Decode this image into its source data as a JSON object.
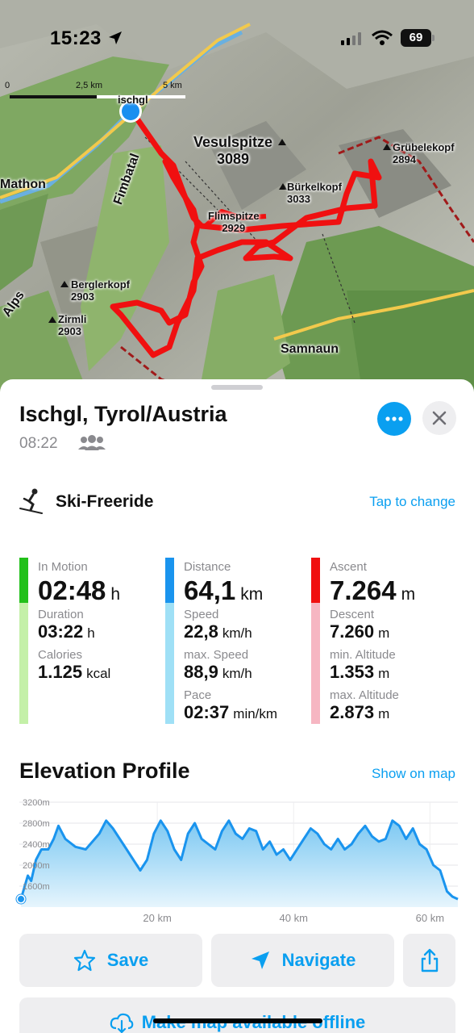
{
  "status_bar": {
    "time": "15:23",
    "battery": "69"
  },
  "map": {
    "scale": {
      "zero": "0",
      "mid": "2,5 km",
      "end": "5 km"
    },
    "labels": {
      "town_partial": "ischgl",
      "vesulspitze_name": "Vesulspitze",
      "vesulspitze_alt": "3089",
      "grubelekopf_name": "Grübelekopf",
      "grubelekopf_alt": "2894",
      "burkelkopf_name": "Bürkelkopf",
      "burkelkopf_alt": "3033",
      "flimspitze_name": "Flimspitze",
      "flimspitze_alt": "2929",
      "mathon": "Mathon",
      "fimbatal": "Fimbatal",
      "alps": "Alps",
      "berglerkopf_name": "Berglerkopf",
      "berglerkopf_alt": "2903",
      "zirmli_name": "Zirmli",
      "zirmli_alt": "2903",
      "samnaun": "Samnaun"
    }
  },
  "sheet": {
    "title": "Ischgl, Tyrol/Austria",
    "time": "08:22",
    "activity": "Ski-Freeride",
    "tap_to_change": "Tap to change",
    "stats": {
      "in_motion_label": "In Motion",
      "in_motion_value": "02:48",
      "in_motion_unit": "h",
      "duration_label": "Duration",
      "duration_value": "03:22",
      "duration_unit": "h",
      "calories_label": "Calories",
      "calories_value": "1.125",
      "calories_unit": "kcal",
      "distance_label": "Distance",
      "distance_value": "64,1",
      "distance_unit": "km",
      "speed_label": "Speed",
      "speed_value": "22,8",
      "speed_unit": "km/h",
      "max_speed_label": "max. Speed",
      "max_speed_value": "88,9",
      "max_speed_unit": "km/h",
      "pace_label": "Pace",
      "pace_value": "02:37",
      "pace_unit": "min/km",
      "ascent_label": "Ascent",
      "ascent_value": "7.264",
      "ascent_unit": "m",
      "descent_label": "Descent",
      "descent_value": "7.260",
      "descent_unit": "m",
      "min_alt_label": "min. Altitude",
      "min_alt_value": "1.353",
      "min_alt_unit": "m",
      "max_alt_label": "max. Altitude",
      "max_alt_value": "2.873",
      "max_alt_unit": "m"
    },
    "colors": {
      "motion_dark": "#22c01a",
      "motion_light": "#c4f0a8",
      "distance_dark": "#1a94ee",
      "distance_light": "#9fe0f6",
      "ascent_dark": "#f01010",
      "ascent_light": "#f6b6c2",
      "accent": "#0a9ff0"
    },
    "elevation_title": "Elevation Profile",
    "show_on_map": "Show on map",
    "buttons": {
      "save": "Save",
      "navigate": "Navigate",
      "offline": "Make map available offline"
    }
  },
  "chart_data": {
    "type": "area",
    "title": "Elevation Profile",
    "xlabel": "",
    "ylabel": "",
    "x_unit": "km",
    "y_unit": "m",
    "xlim": [
      0,
      64.1
    ],
    "ylim": [
      1200,
      3200
    ],
    "x_ticks": [
      "20 km",
      "40 km",
      "60 km"
    ],
    "y_ticks": [
      "3200m",
      "2800m",
      "2400m",
      "2000m",
      "1600m"
    ],
    "x": [
      0,
      1,
      1.5,
      2.2,
      3,
      4,
      4.8,
      5.5,
      6.5,
      8,
      9.5,
      10.5,
      11.5,
      12.5,
      13.5,
      14.5,
      15.5,
      16.5,
      17.5,
      18.5,
      19.5,
      20.5,
      21.5,
      22.5,
      23.5,
      24.5,
      25.5,
      26.5,
      27.5,
      28.5,
      29.5,
      30.5,
      31.5,
      32.5,
      33.5,
      34.5,
      35.5,
      36.5,
      37.5,
      38.5,
      39.5,
      40.5,
      41.5,
      42.5,
      43.5,
      44.5,
      45.5,
      46.5,
      47.5,
      48.5,
      49.5,
      50.5,
      51.5,
      52.5,
      53.5,
      54.5,
      55.5,
      56.5,
      57.5,
      58.5,
      59.5,
      60.5,
      61.5,
      62.5,
      63.3,
      64.1
    ],
    "y": [
      1353,
      1800,
      1700,
      2100,
      2300,
      2300,
      2500,
      2750,
      2500,
      2350,
      2300,
      2450,
      2600,
      2850,
      2700,
      2500,
      2300,
      2100,
      1900,
      2100,
      2600,
      2850,
      2650,
      2300,
      2100,
      2600,
      2800,
      2500,
      2400,
      2300,
      2650,
      2850,
      2600,
      2500,
      2700,
      2650,
      2300,
      2450,
      2200,
      2300,
      2100,
      2300,
      2500,
      2700,
      2600,
      2400,
      2300,
      2500,
      2300,
      2400,
      2600,
      2750,
      2550,
      2450,
      2500,
      2850,
      2750,
      2500,
      2700,
      2400,
      2300,
      2000,
      1900,
      1500,
      1400,
      1353
    ]
  }
}
